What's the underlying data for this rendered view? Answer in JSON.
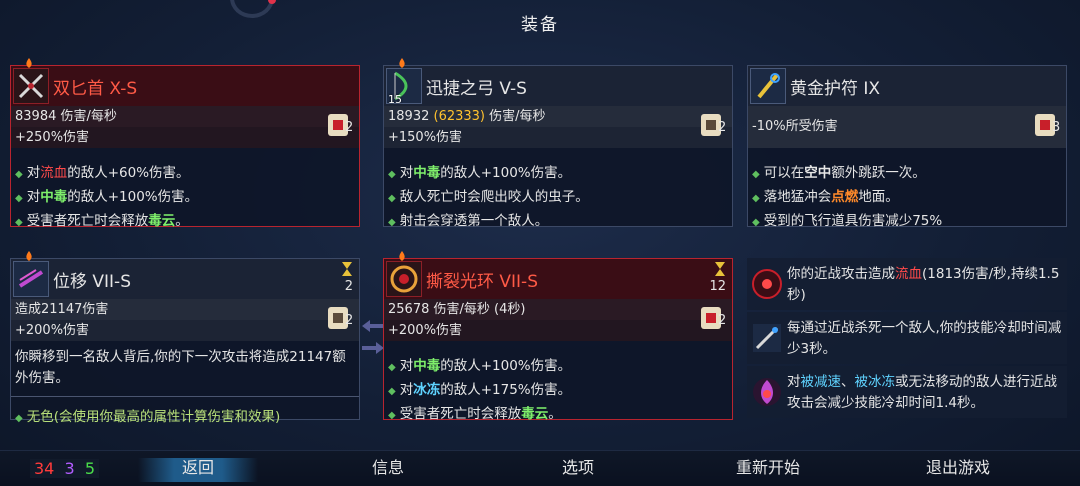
{
  "title": "装备",
  "cards": {
    "dual_daggers": {
      "name": "双匕首 X-S",
      "stat1": "83984 伤害/每秒",
      "stat2": "+250%伤害",
      "scroll_count": "2",
      "effects": [
        {
          "pre": "对",
          "hl": "流血",
          "post": "的敌人+60%伤害。"
        },
        {
          "pre": "对",
          "hl": "中毒",
          "post": "的敌人+100%伤害。"
        },
        {
          "pre": "受害者死亡时会释放",
          "hl": "毒云",
          "post": "。"
        }
      ]
    },
    "swift_bow": {
      "name": "迅捷之弓 V-S",
      "icon_num": "15",
      "stat1_value": "18932",
      "stat1_alt": "(62333)",
      "stat1_unit": "伤害/每秒",
      "stat2": "+150%伤害",
      "scroll_count": "2",
      "effects": [
        {
          "pre": "对",
          "hl": "中毒",
          "post": "的敌人+100%伤害。"
        },
        {
          "pre": "敌人死亡时会爬出咬人的虫子。",
          "hl": "",
          "post": ""
        },
        {
          "pre": "射击会穿透第一个敌人。",
          "hl": "",
          "post": ""
        }
      ]
    },
    "gold_amulet": {
      "name": "黄金护符 IX",
      "stat1": "-10%所受伤害",
      "scroll_count": "3",
      "effects": [
        {
          "pre": "可以在",
          "hl": "空中",
          "post": "额外跳跃一次。"
        },
        {
          "pre": "落地猛冲会",
          "hl": "点燃",
          "post": "地面。"
        },
        {
          "pre": "受到的飞行道具伤害减少75%",
          "hl": "",
          "post": ""
        }
      ]
    },
    "phase": {
      "name": "位移 VII-S",
      "timer": "2",
      "stat1": "造成21147伤害",
      "stat2": "+200%伤害",
      "scroll_count": "2",
      "desc": "你瞬移到一名敌人背后,你的下一次攻击将造成21147额外伤害。",
      "neutral": "无色(会使用你最高的属性计算伤害和效果)"
    },
    "lacerating_aura": {
      "name": "撕裂光环 VII-S",
      "timer": "12",
      "stat1": "25678 伤害/每秒 (4秒)",
      "stat2": "+200%伤害",
      "scroll_count": "2",
      "effects": [
        {
          "pre": "对",
          "hl": "中毒",
          "post": "的敌人+100%伤害。"
        },
        {
          "pre": "对",
          "hl": "冰冻",
          "post": "的敌人+175%伤害。"
        },
        {
          "pre": "受害者死亡时会释放",
          "hl": "毒云",
          "post": "。"
        }
      ]
    }
  },
  "mutations": [
    {
      "p1": "你的近战攻击造成",
      "h1": "流血",
      "p2": "(1813伤害/秒,持续1.5秒)",
      "h2": "",
      "p3": ""
    },
    {
      "p1": "每通过近战杀死一个敌人,你的技能冷却时间减少3秒。",
      "h1": "",
      "p2": "",
      "h2": "",
      "p3": ""
    },
    {
      "p1": "对",
      "h1": "被减速",
      "p2": "、",
      "h2": "被冰冻",
      "p3": "或无法移动的敌人进行近战攻击会减少技能冷却时间1.4秒。"
    }
  ],
  "scrolls": {
    "brutality": "34",
    "tactics": "3",
    "survival": "5"
  },
  "menu": {
    "back": "返回",
    "info": "信息",
    "options": "选项",
    "restart": "重新开始",
    "quit": "退出游戏"
  },
  "colors": {
    "highlight_red": "#ff4a4a",
    "highlight_green": "#7ff06b",
    "highlight_blue": "#5fd3ff",
    "name_red": "#ff5a46",
    "gold": "#ffc22e"
  }
}
